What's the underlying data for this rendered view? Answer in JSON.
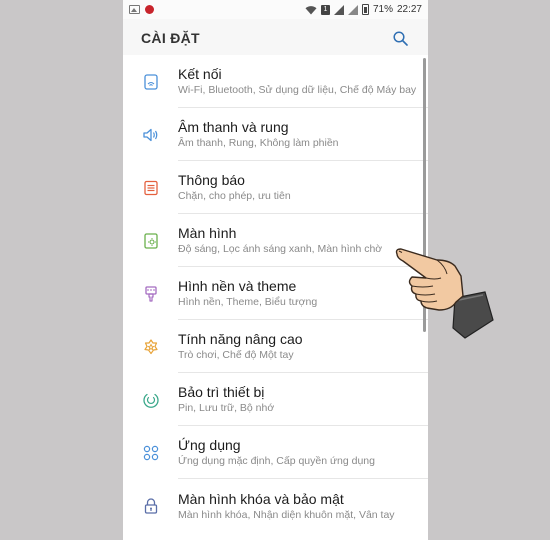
{
  "status_bar": {
    "battery": "71%",
    "time": "22:27",
    "sim": "1"
  },
  "header": {
    "title": "CÀI ĐẶT"
  },
  "items": [
    {
      "title": "Kết nối",
      "subtitle": "Wi-Fi, Bluetooth, Sử dụng dữ liệu, Chế độ Máy bay",
      "icon": "connections-icon",
      "color": "#4a90d9"
    },
    {
      "title": "Âm thanh và rung",
      "subtitle": "Âm thanh, Rung, Không làm phiền",
      "icon": "sound-icon",
      "color": "#4a90d9"
    },
    {
      "title": "Thông báo",
      "subtitle": "Chặn, cho phép, ưu tiên",
      "icon": "notifications-icon",
      "color": "#e4603e"
    },
    {
      "title": "Màn hình",
      "subtitle": "Độ sáng, Lọc ánh sáng xanh, Màn hình chờ",
      "icon": "display-icon",
      "color": "#6ab04c"
    },
    {
      "title": "Hình nền và theme",
      "subtitle": "Hình nền, Theme, Biểu tượng",
      "icon": "wallpaper-icon",
      "color": "#a56cc1"
    },
    {
      "title": "Tính năng nâng cao",
      "subtitle": "Trò chơi, Chế độ Một tay",
      "icon": "advanced-features-icon",
      "color": "#e8a43a"
    },
    {
      "title": "Bảo trì thiết bị",
      "subtitle": "Pin, Lưu trữ, Bộ nhớ",
      "icon": "device-maintenance-icon",
      "color": "#3aa88a"
    },
    {
      "title": "Ứng dụng",
      "subtitle": "Ứng dụng mặc định, Cấp quyền ứng dụng",
      "icon": "apps-icon",
      "color": "#4a90d9"
    },
    {
      "title": "Màn hình khóa và bảo mật",
      "subtitle": "Màn hình khóa, Nhận diện khuôn mặt, Vân tay",
      "icon": "lock-icon",
      "color": "#5a6ea8"
    }
  ]
}
